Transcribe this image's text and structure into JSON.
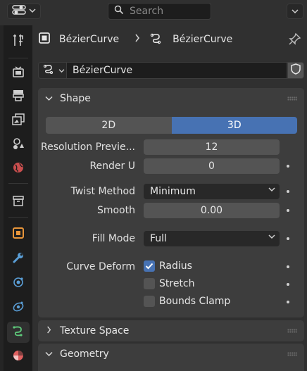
{
  "header": {
    "search_placeholder": "Search"
  },
  "tabs": [
    {
      "name": "tool-tab",
      "icon": "tool-icon"
    },
    {
      "name": "render-tab",
      "icon": "render-icon"
    },
    {
      "name": "output-tab",
      "icon": "output-icon"
    },
    {
      "name": "view-layer-tab",
      "icon": "view-layer-icon"
    },
    {
      "name": "scene-tab",
      "icon": "scene-icon"
    },
    {
      "name": "world-tab",
      "icon": "world-icon"
    },
    {
      "name": "collection-tab",
      "icon": "collection-icon"
    },
    {
      "name": "object-tab",
      "icon": "object-icon"
    },
    {
      "name": "modifiers-tab",
      "icon": "modifier-wrench-icon"
    },
    {
      "name": "particles-tab",
      "icon": "particles-icon"
    },
    {
      "name": "physics-tab",
      "icon": "physics-icon"
    },
    {
      "name": "curve-data-tab",
      "icon": "curve-data-icon",
      "active": true
    },
    {
      "name": "material-tab",
      "icon": "material-icon"
    }
  ],
  "breadcrumb": {
    "object": "BézierCurve",
    "data": "BézierCurve"
  },
  "datablock": {
    "name": "BézierCurve"
  },
  "panels": {
    "shape": {
      "title": "Shape",
      "dimension_2d": "2D",
      "dimension_3d": "3D",
      "selected_dimension": "3D",
      "resolution_preview_label": "Resolution Previe...",
      "resolution_preview_value": "12",
      "render_u_label": "Render U",
      "render_u_value": "0",
      "twist_method_label": "Twist Method",
      "twist_method_value": "Minimum",
      "smooth_label": "Smooth",
      "smooth_value": "0.00",
      "fill_mode_label": "Fill Mode",
      "fill_mode_value": "Full",
      "curve_deform_label": "Curve Deform",
      "radius_label": "Radius",
      "radius_checked": true,
      "stretch_label": "Stretch",
      "stretch_checked": false,
      "bounds_clamp_label": "Bounds Clamp",
      "bounds_clamp_checked": false
    },
    "texture_space": {
      "title": "Texture Space"
    },
    "geometry": {
      "title": "Geometry"
    }
  },
  "colors": {
    "accent": "#4772b3",
    "panel_bg": "#3d3d3d",
    "editor_bg": "#303030",
    "tabbar_bg": "#1d1d1d",
    "object_orange": "#e8953a",
    "curve_green": "#5ec87a"
  }
}
